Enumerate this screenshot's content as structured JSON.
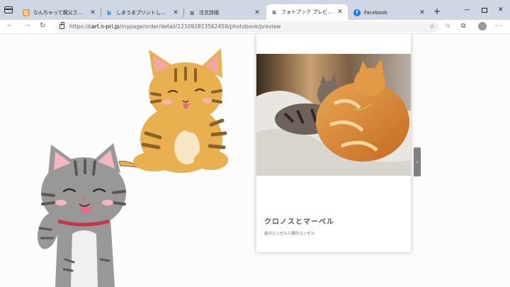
{
  "browser": {
    "tabs": [
      {
        "title": "なんちゃって親父さんの猫日記 -",
        "favicon": "blog-favicon",
        "active": false
      },
      {
        "title": "しまうまプリントしまうま - Bing",
        "favicon": "bing-favicon",
        "active": false
      },
      {
        "title": "注文詳細",
        "favicon": "page-favicon",
        "active": false
      },
      {
        "title": "フォトブック プレビュー",
        "favicon": "page-favicon",
        "active": true
      },
      {
        "title": "Facebook",
        "favicon": "facebook-favicon",
        "active": false
      }
    ],
    "address": {
      "prefix": "https://",
      "domain": "cart.n-pri.jp",
      "path": "/mypage/order/detail/121092813562459/photobook/preview"
    }
  },
  "preview": {
    "book_title": "クロノスとマーベル",
    "book_subtitle": "金のエンゼルと銀のエンゼル"
  },
  "colors": {
    "tabstrip": "#cfd6e4",
    "facebook": "#1877f2",
    "bing": "#0b84d8",
    "orange_cat": "#e8b04f",
    "gray_cat": "#9a9896"
  }
}
